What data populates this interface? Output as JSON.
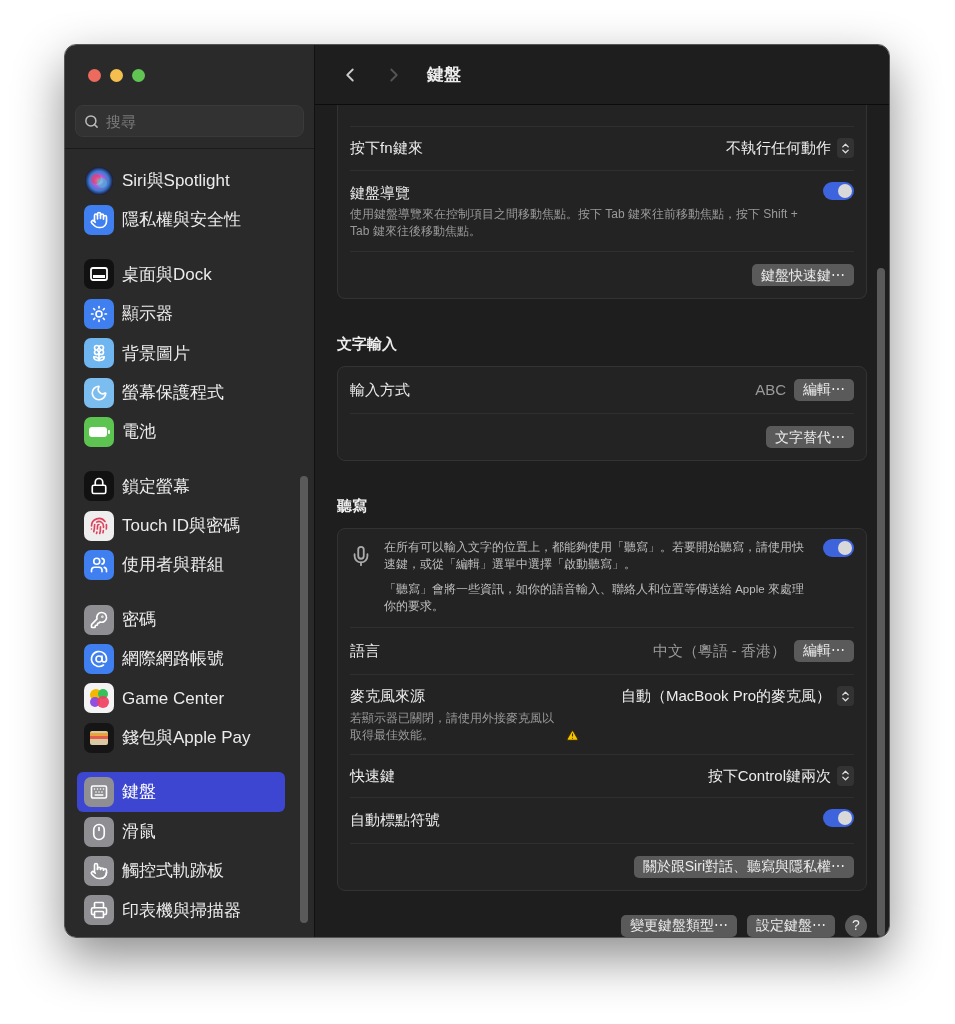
{
  "sidebar": {
    "search": {
      "placeholder": "搜尋"
    },
    "groups": [
      [
        {
          "label": "Siri與Spotlight",
          "kind": "siri",
          "selected": false
        },
        {
          "label": "隱私權與安全性",
          "kind": "hand",
          "selected": false
        }
      ],
      [
        {
          "label": "桌面與Dock",
          "kind": "dock",
          "selected": false
        },
        {
          "label": "顯示器",
          "kind": "sun",
          "selected": false
        },
        {
          "label": "背景圖片",
          "kind": "flower",
          "selected": false
        },
        {
          "label": "螢幕保護程式",
          "kind": "screensaver",
          "selected": false
        },
        {
          "label": "電池",
          "kind": "battery",
          "selected": false
        }
      ],
      [
        {
          "label": "鎖定螢幕",
          "kind": "lock",
          "selected": false
        },
        {
          "label": "Touch ID與密碼",
          "kind": "fingerprint",
          "selected": false
        },
        {
          "label": "使用者與群組",
          "kind": "users",
          "selected": false
        }
      ],
      [
        {
          "label": "密碼",
          "kind": "key",
          "selected": false
        },
        {
          "label": "網際網路帳號",
          "kind": "at",
          "selected": false
        },
        {
          "label": "Game Center",
          "kind": "gamecenter",
          "selected": false
        },
        {
          "label": "錢包與Apple Pay",
          "kind": "wallet",
          "selected": false
        }
      ],
      [
        {
          "label": "鍵盤",
          "kind": "keyboard",
          "selected": true
        },
        {
          "label": "滑鼠",
          "kind": "mouse",
          "selected": false
        },
        {
          "label": "觸控式軌跡板",
          "kind": "trackpad",
          "selected": false
        },
        {
          "label": "印表機與掃描器",
          "kind": "printer",
          "selected": false
        }
      ]
    ]
  },
  "toolbar": {
    "title": "鍵盤"
  },
  "sections": [
    {
      "rows": [
        {
          "kind": "select",
          "label": "按下fn鍵來",
          "value": "不執行任何動作"
        },
        {
          "kind": "toggle",
          "label": "鍵盤導覽",
          "description": "使用鍵盤導覽來在控制項目之間移動焦點。按下 Tab 鍵來往前移動焦點，按下 Shift + Tab 鍵來往後移動焦點。",
          "on": true
        },
        {
          "kind": "button",
          "button": "鍵盤快速鍵⋯"
        }
      ]
    },
    {
      "heading": "文字輸入",
      "rows": [
        {
          "kind": "value_edit",
          "label": "輸入方式",
          "value": "ABC",
          "button": "編輯⋯"
        },
        {
          "kind": "button",
          "button": "文字替代⋯"
        }
      ]
    },
    {
      "heading": "聽寫",
      "rows": [
        {
          "kind": "info_toggle",
          "paragraphs": [
            "在所有可以輸入文字的位置上，都能夠使用「聽寫」。若要開始聽寫，請使用快速鍵，或從「編輯」選單中選擇「啟動聽寫」。",
            "「聽寫」會將一些資訊，如你的語音輸入、聯絡人和位置等傳送給 Apple 來處理你的要求。"
          ],
          "on": true
        },
        {
          "kind": "value_edit",
          "label": "語言",
          "value": "中文（粵語 - 香港）",
          "button": "編輯⋯"
        },
        {
          "kind": "select",
          "label": "麥克風來源",
          "description": "若顯示器已關閉，請使用外接麥克風以取得最佳效能。",
          "warning": true,
          "value": "自動（MacBook Pro的麥克風）"
        },
        {
          "kind": "select",
          "label": "快速鍵",
          "value": "按下Control鍵兩次"
        },
        {
          "kind": "toggle",
          "label": "自動標點符號",
          "on": true
        },
        {
          "kind": "button",
          "button": "關於跟Siri對話、聽寫與隱私權⋯"
        }
      ]
    }
  ],
  "footer": {
    "buttons": [
      "變更鍵盤類型⋯",
      "設定鍵盤⋯"
    ],
    "help": "?"
  }
}
